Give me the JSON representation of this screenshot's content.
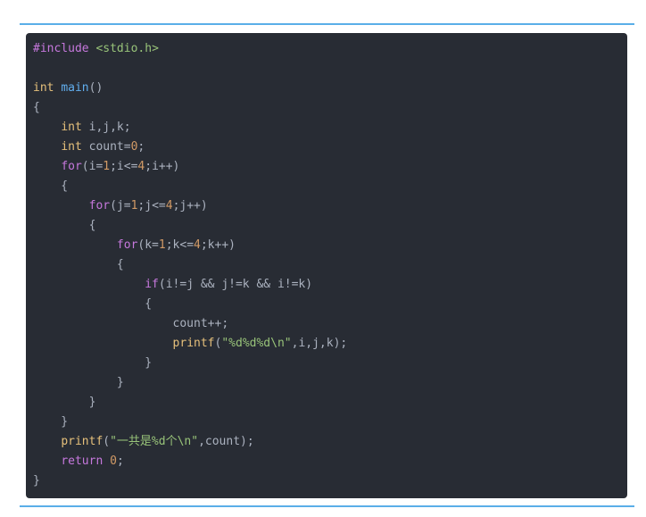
{
  "code": {
    "language": "c",
    "lines": [
      [
        {
          "t": "meta",
          "v": "#include "
        },
        {
          "t": "str",
          "v": "<stdio.h>"
        }
      ],
      [],
      [
        {
          "t": "type",
          "v": "int"
        },
        {
          "t": "plain",
          "v": " "
        },
        {
          "t": "fn",
          "v": "main"
        },
        {
          "t": "plain",
          "v": "()"
        }
      ],
      [
        {
          "t": "plain",
          "v": "{"
        }
      ],
      [
        {
          "t": "plain",
          "v": "    "
        },
        {
          "t": "type",
          "v": "int"
        },
        {
          "t": "plain",
          "v": " i,j,k;"
        }
      ],
      [
        {
          "t": "plain",
          "v": "    "
        },
        {
          "t": "type",
          "v": "int"
        },
        {
          "t": "plain",
          "v": " count="
        },
        {
          "t": "num",
          "v": "0"
        },
        {
          "t": "plain",
          "v": ";"
        }
      ],
      [
        {
          "t": "plain",
          "v": "    "
        },
        {
          "t": "kw",
          "v": "for"
        },
        {
          "t": "plain",
          "v": "(i="
        },
        {
          "t": "num",
          "v": "1"
        },
        {
          "t": "plain",
          "v": ";i<="
        },
        {
          "t": "num",
          "v": "4"
        },
        {
          "t": "plain",
          "v": ";i++)"
        }
      ],
      [
        {
          "t": "plain",
          "v": "    {"
        }
      ],
      [
        {
          "t": "plain",
          "v": "        "
        },
        {
          "t": "kw",
          "v": "for"
        },
        {
          "t": "plain",
          "v": "(j="
        },
        {
          "t": "num",
          "v": "1"
        },
        {
          "t": "plain",
          "v": ";j<="
        },
        {
          "t": "num",
          "v": "4"
        },
        {
          "t": "plain",
          "v": ";j++)"
        }
      ],
      [
        {
          "t": "plain",
          "v": "        {"
        }
      ],
      [
        {
          "t": "plain",
          "v": "            "
        },
        {
          "t": "kw",
          "v": "for"
        },
        {
          "t": "plain",
          "v": "(k="
        },
        {
          "t": "num",
          "v": "1"
        },
        {
          "t": "plain",
          "v": ";k<="
        },
        {
          "t": "num",
          "v": "4"
        },
        {
          "t": "plain",
          "v": ";k++)"
        }
      ],
      [
        {
          "t": "plain",
          "v": "            {"
        }
      ],
      [
        {
          "t": "plain",
          "v": "                "
        },
        {
          "t": "kw",
          "v": "if"
        },
        {
          "t": "plain",
          "v": "(i!=j && j!=k && i!=k)"
        }
      ],
      [
        {
          "t": "plain",
          "v": "                {"
        }
      ],
      [
        {
          "t": "plain",
          "v": "                    count++;"
        }
      ],
      [
        {
          "t": "plain",
          "v": "                    "
        },
        {
          "t": "call",
          "v": "printf"
        },
        {
          "t": "plain",
          "v": "("
        },
        {
          "t": "str",
          "v": "\"%d%d%d\\n\""
        },
        {
          "t": "plain",
          "v": ",i,j,k);"
        }
      ],
      [
        {
          "t": "plain",
          "v": "                }"
        }
      ],
      [
        {
          "t": "plain",
          "v": "            }"
        }
      ],
      [
        {
          "t": "plain",
          "v": "        }"
        }
      ],
      [
        {
          "t": "plain",
          "v": "    }"
        }
      ],
      [
        {
          "t": "plain",
          "v": "    "
        },
        {
          "t": "call",
          "v": "printf"
        },
        {
          "t": "plain",
          "v": "("
        },
        {
          "t": "str",
          "v": "\"一共是%d个\\n\""
        },
        {
          "t": "plain",
          "v": ",count);"
        }
      ],
      [
        {
          "t": "plain",
          "v": "    "
        },
        {
          "t": "kw",
          "v": "return"
        },
        {
          "t": "plain",
          "v": " "
        },
        {
          "t": "num",
          "v": "0"
        },
        {
          "t": "plain",
          "v": ";"
        }
      ],
      [
        {
          "t": "plain",
          "v": "}"
        }
      ]
    ]
  },
  "colors": {
    "background": "#282c34",
    "rule": "#5aaee8",
    "keyword": "#c678dd",
    "string": "#98c379",
    "type": "#e5c07b",
    "number": "#d19a66",
    "function": "#61aeee",
    "plain": "#abb2bf"
  }
}
